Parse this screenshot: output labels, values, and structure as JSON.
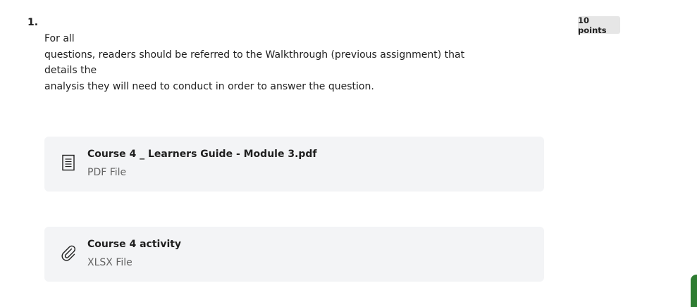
{
  "question": {
    "number": "1.",
    "points": "10 points",
    "prompt_line1": "For all",
    "prompt_line2": "questions, readers should be referred to the Walkthrough (previous assignment) that details the",
    "prompt_line3": "analysis they will need to conduct in order to answer the question."
  },
  "attachments": [
    {
      "title": "Course 4 _ Learners Guide - Module 3.pdf",
      "type": "PDF File",
      "icon": "document-icon"
    },
    {
      "title": "Course 4 activity",
      "type": "XLSX File",
      "icon": "paperclip-icon"
    }
  ],
  "colors": {
    "badge_bg": "#e6e6e6",
    "card_bg": "#f3f4f6",
    "accent_green": "#2e7d32"
  }
}
